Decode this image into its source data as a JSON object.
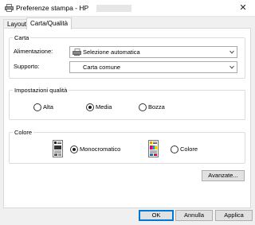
{
  "window": {
    "title": "Preferenze stampa - HP"
  },
  "tabs": [
    {
      "label": "Layout"
    },
    {
      "label": "Carta/Qualità"
    }
  ],
  "carta": {
    "legend": "Carta",
    "alimentazione": {
      "label": "Alimentazione:",
      "value": "Selezione automatica"
    },
    "supporto": {
      "label": "Supporto:",
      "value": "Carta comune"
    }
  },
  "qualita": {
    "legend": "Impostazioni qualità",
    "options": [
      {
        "label": "Alta",
        "checked": false
      },
      {
        "label": "Media",
        "checked": true
      },
      {
        "label": "Bozza",
        "checked": false
      }
    ]
  },
  "colore": {
    "legend": "Colore",
    "options": [
      {
        "label": "Monocromatico",
        "checked": true
      },
      {
        "label": "Colore",
        "checked": false
      }
    ]
  },
  "buttons": {
    "advanced": "Avanzate...",
    "ok": "OK",
    "cancel": "Annulla",
    "apply": "Applica"
  },
  "colors": {
    "accent": "#0078d7",
    "background": "#f0f0f0"
  }
}
